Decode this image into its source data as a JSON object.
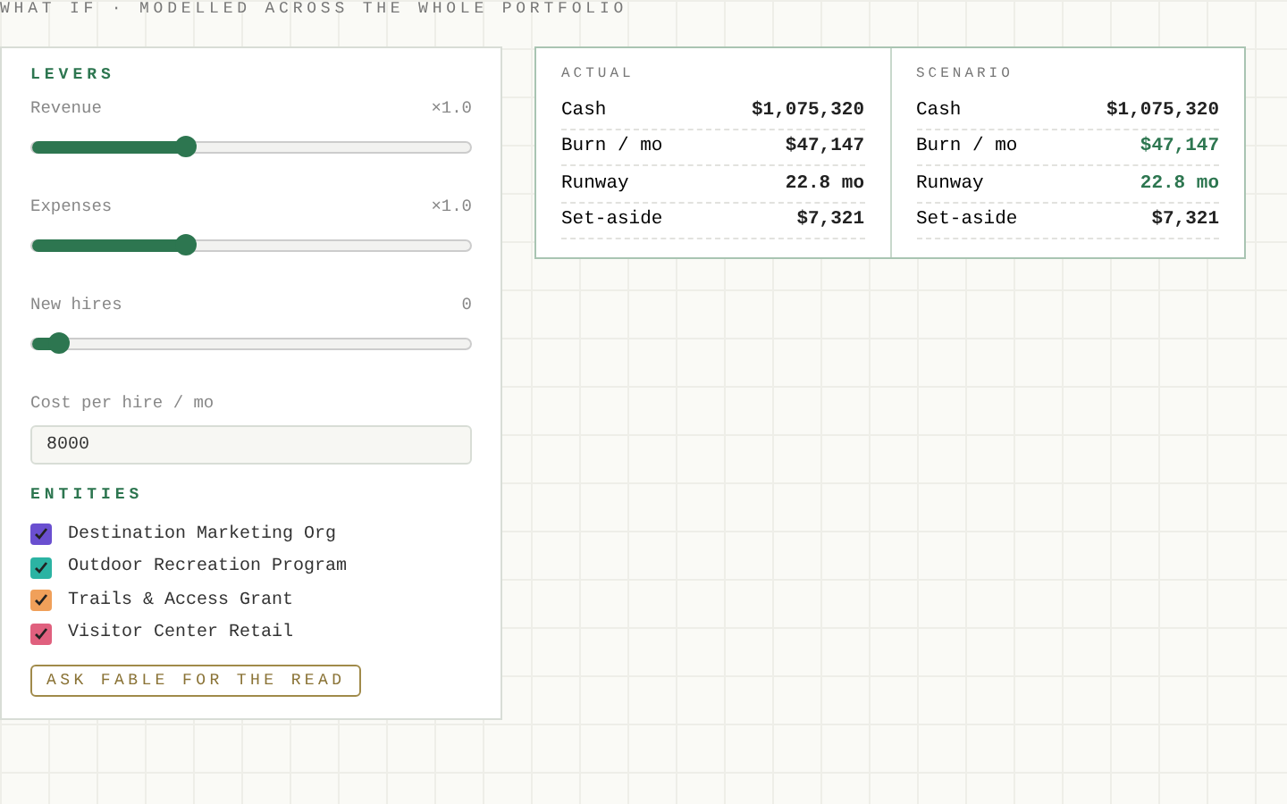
{
  "heading": "WHAT IF · MODELLED ACROSS THE WHOLE PORTFOLIO",
  "levers": {
    "title": "LEVERS",
    "sliders": [
      {
        "label": "Revenue",
        "reading": "×1.0",
        "level": 0.35
      },
      {
        "label": "Expenses",
        "reading": "×1.0",
        "level": 0.35
      },
      {
        "label": "New hires",
        "reading": "0",
        "level": 0.06
      }
    ],
    "cost_field": {
      "label": "Cost per hire / mo",
      "value": "8000"
    }
  },
  "entities": {
    "title": "ENTITIES",
    "items": [
      {
        "label": "Destination Marketing Org",
        "checked": true,
        "color": "#6a4fd0"
      },
      {
        "label": "Outdoor Recreation Program",
        "checked": true,
        "color": "#2bb3a3"
      },
      {
        "label": "Trails & Access Grant",
        "checked": true,
        "color": "#f0a05a"
      },
      {
        "label": "Visitor Center Retail",
        "checked": true,
        "color": "#e0607e"
      }
    ]
  },
  "ask_button": "ASK FABLE FOR THE READ",
  "comparison": [
    {
      "title": "ACTUAL",
      "rows": [
        {
          "label": "Cash",
          "value": "$1,075,320",
          "highlight": false
        },
        {
          "label": "Burn / mo",
          "value": "$47,147",
          "highlight": false
        },
        {
          "label": "Runway",
          "value": "22.8 mo",
          "highlight": false
        },
        {
          "label": "Set-aside",
          "value": "$7,321",
          "highlight": false
        }
      ]
    },
    {
      "title": "SCENARIO",
      "rows": [
        {
          "label": "Cash",
          "value": "$1,075,320",
          "highlight": false
        },
        {
          "label": "Burn / mo",
          "value": "$47,147",
          "highlight": true
        },
        {
          "label": "Runway",
          "value": "22.8 mo",
          "highlight": true
        },
        {
          "label": "Set-aside",
          "value": "$7,321",
          "highlight": false
        }
      ]
    }
  ]
}
